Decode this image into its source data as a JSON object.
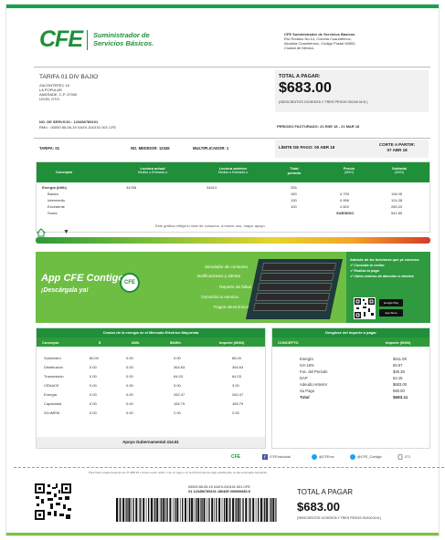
{
  "brand": {
    "logo": "CFE",
    "name_line1": "Suministrador de",
    "name_line2": "Servicios Básicos."
  },
  "supplier_lines": [
    "CFE Suministrador de Servicios Básicos",
    "Río Ródano No.14, Colonia Cuauhtémoc,",
    "Alcaldía Cuauhtémoc, Código Postal 06500,",
    "Ciudad de México."
  ],
  "bill": {
    "tariff_title": "TARIFA 01 DIV BAJIO",
    "address_lines": [
      "ZACONTEPEC 15",
      "LA POPULAR",
      "ANDRADE, C.P. 37000",
      "LEON, GTO."
    ],
    "total_label": "TOTAL A PAGAR:",
    "total_amount": "$683.00",
    "total_words": "(SEISCIENTOS OCHENTA Y TRES PESOS 00/100 M.N.)",
    "service_no": "NO. DE SERVICIO :  123456789101",
    "rmu": "RMU :  00000 85-05-19 XAXX-010101 001 CFE",
    "period": "PERIODO FACTURADO:  21 ENE 18 - 21 MAR 18",
    "tarifa": "TARIFA: 01",
    "medidor": "NO. MEDIDOR: 12345",
    "multiplicador": "MULTIPLICADOR: 1",
    "limit": "LÍMITE DE PAGO: 05 ABR 18",
    "cut_line1": "CORTE A PARTIR:",
    "cut_line2": "07 ABR 18"
  },
  "consumption": {
    "headers": {
      "concepto": "Concepto",
      "actual": "Lectura actual",
      "anterior": "Lectura anterior",
      "total": "Total",
      "periodo": "periodo",
      "precio": "Precio",
      "subtotal": "Subtotal",
      "sub_medida": "Medida",
      "sub_estimada": "Estimada",
      "unit": "(MXN)"
    },
    "energy": "Energía (kWh)",
    "lectura_actual": "34768",
    "lectura_anterior": "34513",
    "total_periodo": "255",
    "rows": [
      {
        "label": "Básico",
        "kwh": "150",
        "price": "0.793",
        "subtotal": "118.95"
      },
      {
        "label": "Intermedio",
        "kwh": "130",
        "price": "0.956",
        "subtotal": "124.28"
      },
      {
        "label": "Excedente",
        "kwh": "100",
        "price": "2.802",
        "subtotal": "280.20"
      },
      {
        "label": "Suma",
        "kwh": "",
        "price": "SUBSIDIO",
        "subtotal": "541.65"
      }
    ],
    "graph_note": "Este gráfico refleja tu nivel de consumo. A menor uso, mayor apoyo."
  },
  "app": {
    "title": "App CFE Contigo",
    "subtitle": "¡Descárgala ya!",
    "logo_text": "CFE",
    "features": [
      "Simulador de consumo",
      "Notificaciones y alertas",
      "Reporte de fallas",
      "Domicilio tu servicio",
      "Pagos electrónicos"
    ],
    "bullets_title": "Además de las funciones que ya conoces:",
    "bullets": [
      "Consulta tu recibo",
      "Realiza tu pago",
      "Ubica centros de atención a clientes"
    ],
    "store1": "Google Play",
    "store2": "App Store"
  },
  "breakdown": {
    "title": "Costos de la energía en el Mercado Eléctrico Mayorista",
    "headers": [
      "Concepto",
      "$",
      "kWh",
      "$/kWh",
      "Importe (MXN)"
    ],
    "rows": [
      {
        "c": "Suministro",
        "a": "80.00",
        "b": "0.00",
        "d": "0.00",
        "e": "86.00"
      },
      {
        "c": "Distribución",
        "a": "0.00",
        "b": "0.00",
        "d": "364.63",
        "e": "364.63"
      },
      {
        "c": "Transmisión",
        "a": "0.00",
        "b": "0.00",
        "d": "64.03",
        "e": "64.03"
      },
      {
        "c": "CENACE",
        "a": "0.00",
        "b": "0.00",
        "d": "3.00",
        "e": "3.00"
      },
      {
        "c": "Energía",
        "a": "0.00",
        "b": "0.00",
        "d": "262.47",
        "e": "262.47"
      },
      {
        "c": "Capacidad",
        "a": "0.00",
        "b": "0.00",
        "d": "165.79",
        "e": "165.79"
      },
      {
        "c": "SCnMEM",
        "a": "0.00",
        "b": "0.00",
        "d": "2.00",
        "e": "2.00"
      }
    ],
    "apoyo": "Apoyo Gubernamental 414.61"
  },
  "summary": {
    "title": "Desglose del importe a pagar",
    "col1": "CONCEPTO",
    "col2": "Importe (MXN)",
    "rows": [
      {
        "label": "Energía",
        "value": "$411.08"
      },
      {
        "label": "IVA 16%",
        "value": "65.97"
      },
      {
        "label": "Fac. del Periodo",
        "value": "$36.38"
      },
      {
        "label": "DAP",
        "value": "54.15"
      },
      {
        "label": "Adeudo Anterior",
        "value": "$683.00"
      },
      {
        "label": "Su Pago",
        "value": "680.00"
      }
    ],
    "total_label": "Total",
    "total_value": "$683.11"
  },
  "social": {
    "cfe": "CFE",
    "facebook": "/CFEnacional",
    "twitter1": "@CFEmx",
    "twitter2": "@CFE_Contigo",
    "phone": "071"
  },
  "stub": {
    "fine_print": "Para hacer pagos después de 07 ABR 18 o antes a este recibo. Con su pago o en la fecha límite de pago establecida, en las sucursales bancarias.",
    "ref_line1": "00000 85-05-19 XAXX-010101 001 CFE",
    "ref_line2": "01  123456789101  180405  000000683  8",
    "label": "TOTAL A PAGAR",
    "amount": "$683.00",
    "words": "(SEISCIENTOS OCHENTA Y TRES PESOS 00/100 M.N.)"
  },
  "colors": {
    "brand_green": "#1f8f3a",
    "banner_green": "#6fbe44"
  }
}
